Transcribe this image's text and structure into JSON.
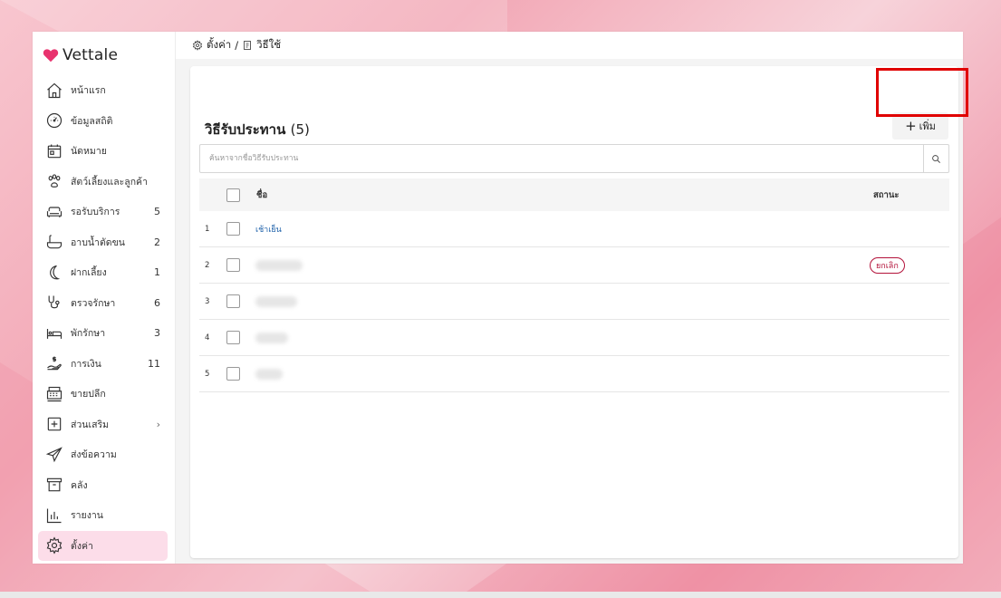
{
  "app": {
    "brand": "Vettale",
    "brand_color": "#e8336e"
  },
  "breadcrumb": {
    "settings": "ตั้งค่า",
    "separator": "/",
    "current": "วิธีใช้"
  },
  "sidebar": {
    "items": [
      {
        "label": "หน้าแรก",
        "icon": "home-icon"
      },
      {
        "label": "ข้อมูลสถิติ",
        "icon": "dashboard-icon"
      },
      {
        "label": "นัดหมาย",
        "icon": "calendar-icon"
      },
      {
        "label": "สัตว์เลี้ยงและลูกค้า",
        "icon": "paw-icon"
      },
      {
        "label": "รอรับบริการ",
        "icon": "sofa-icon",
        "count": "5"
      },
      {
        "label": "อาบน้ำตัดขน",
        "icon": "bath-icon",
        "count": "2"
      },
      {
        "label": "ฝากเลี้ยง",
        "icon": "moon-icon",
        "count": "1"
      },
      {
        "label": "ตรวจรักษา",
        "icon": "stethoscope-icon",
        "count": "6"
      },
      {
        "label": "พักรักษา",
        "icon": "bed-icon",
        "count": "3"
      },
      {
        "label": "การเงิน",
        "icon": "money-hand-icon",
        "count": "11"
      },
      {
        "label": "ขายปลีก",
        "icon": "cash-register-icon"
      },
      {
        "label": "ส่วนเสริม",
        "icon": "plus-square-icon",
        "chevron": "›"
      },
      {
        "label": "ส่งข้อความ",
        "icon": "paper-plane-icon"
      },
      {
        "label": "คลัง",
        "icon": "archive-icon"
      },
      {
        "label": "รายงาน",
        "icon": "bar-chart-icon"
      },
      {
        "label": "ตั้งค่า",
        "icon": "gear-icon",
        "active": true
      }
    ]
  },
  "main": {
    "title": "วิธีรับประทาน",
    "title_count": "(5)",
    "add_button": "เพิ่ม",
    "add_symbol": "+",
    "search_placeholder": "ค้นหาจากชื่อวิธีรับประทาน",
    "table": {
      "columns": {
        "name": "ชื่อ",
        "status": "สถานะ"
      },
      "rows": [
        {
          "index": "1",
          "name": "เช้าเย็น",
          "status": ""
        },
        {
          "index": "2",
          "name": "",
          "status": "ยกเลิก"
        },
        {
          "index": "3",
          "name": "",
          "status": ""
        },
        {
          "index": "4",
          "name": "",
          "status": ""
        },
        {
          "index": "5",
          "name": "",
          "status": ""
        }
      ]
    }
  },
  "colors": {
    "active_bg": "#fcdde9",
    "link": "#1a5ea8",
    "badge": "#b3123a",
    "highlight": "#e00000"
  }
}
